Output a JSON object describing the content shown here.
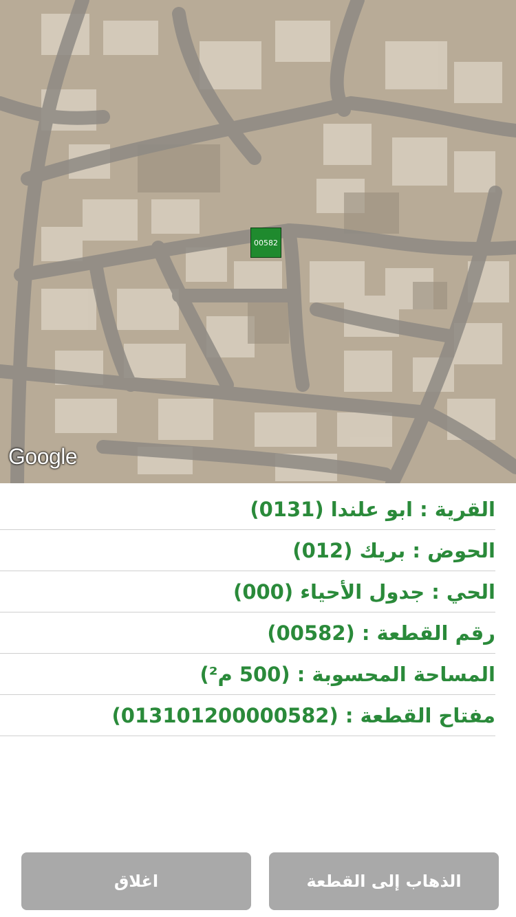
{
  "map": {
    "parcel_label": "00582",
    "attribution": "Google"
  },
  "info": {
    "rows": [
      {
        "label": "القرية : ابو علندا (0131)"
      },
      {
        "label": "الحوض : بريك (012)"
      },
      {
        "label": "الحي : جدول الأحياء (000)"
      },
      {
        "label": "رقم القطعة : (00582)"
      },
      {
        "label": "المساحة المحسوبة : (500 م²)"
      },
      {
        "label": "مفتاح القطعة : (013101200000582)"
      }
    ]
  },
  "buttons": {
    "close_label": "اغلاق",
    "goto_label": "الذهاب إلى القطعة"
  },
  "colors": {
    "accent_green": "#2a8a3a",
    "button_gray": "#a9a9a9",
    "parcel_fill": "#1f8a2e"
  }
}
